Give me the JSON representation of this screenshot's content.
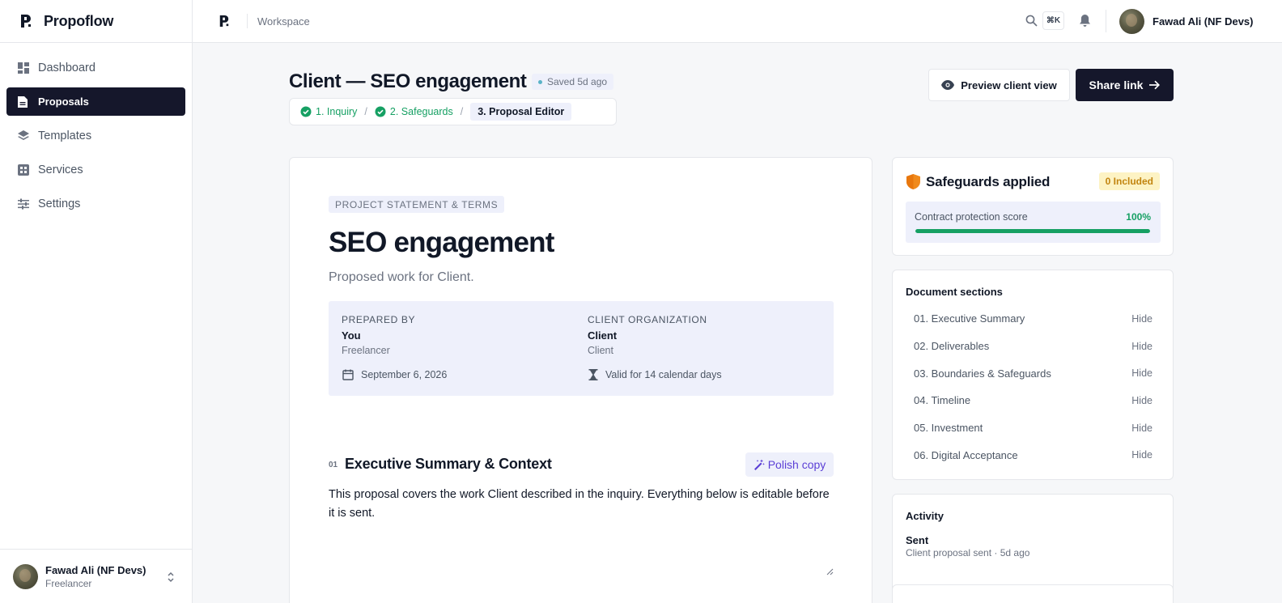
{
  "brand": {
    "name": "Propoflow"
  },
  "sidebar": {
    "items": [
      {
        "label": "Dashboard",
        "icon": "dashboard-icon",
        "active": false
      },
      {
        "label": "Proposals",
        "icon": "document-icon",
        "active": true
      },
      {
        "label": "Templates",
        "icon": "layers-icon",
        "active": false
      },
      {
        "label": "Services",
        "icon": "grid-icon",
        "active": false
      },
      {
        "label": "Settings",
        "icon": "sliders-icon",
        "active": false
      }
    ],
    "footer": {
      "name": "Fawad Ali (NF Devs)",
      "role": "Freelancer"
    }
  },
  "topbar": {
    "workspace": "Workspace",
    "shortcut": "⌘K",
    "user": "Fawad Ali (NF Devs)"
  },
  "header": {
    "title": "Client — SEO engagement",
    "saved": "Saved 5d ago",
    "steps": [
      "1. Inquiry",
      "2. Safeguards",
      "3. Proposal Editor"
    ],
    "preview_label": "Preview client view",
    "share_label": "Share link"
  },
  "document": {
    "tag": "PROJECT STATEMENT & TERMS",
    "title": "SEO engagement",
    "subtitle": "Proposed work for Client.",
    "prepared_by": {
      "label": "PREPARED BY",
      "value": "You",
      "sub": "Freelancer",
      "date": "September 6, 2026"
    },
    "client_org": {
      "label": "CLIENT ORGANIZATION",
      "value": "Client",
      "sub": "Client",
      "validity": "Valid for 14 calendar days"
    },
    "section": {
      "number": "01",
      "title": "Executive Summary & Context",
      "polish_label": "Polish copy",
      "body": "This proposal covers the work Client described in the inquiry. Everything below is editable before it is sent."
    }
  },
  "safeguards": {
    "title": "Safeguards applied",
    "badge": "0 Included",
    "score_label": "Contract protection score",
    "score_text": "100%",
    "score_value": 1.0,
    "accent": "#16a063"
  },
  "sections_panel": {
    "title": "Document sections",
    "hide_label": "Hide",
    "items": [
      "01. Executive Summary",
      "02. Deliverables",
      "03. Boundaries & Safeguards",
      "04. Timeline",
      "05. Investment",
      "06. Digital Acceptance"
    ]
  },
  "activity": {
    "title": "Activity",
    "item": "Sent",
    "sub": "Client proposal sent · 5d ago"
  }
}
